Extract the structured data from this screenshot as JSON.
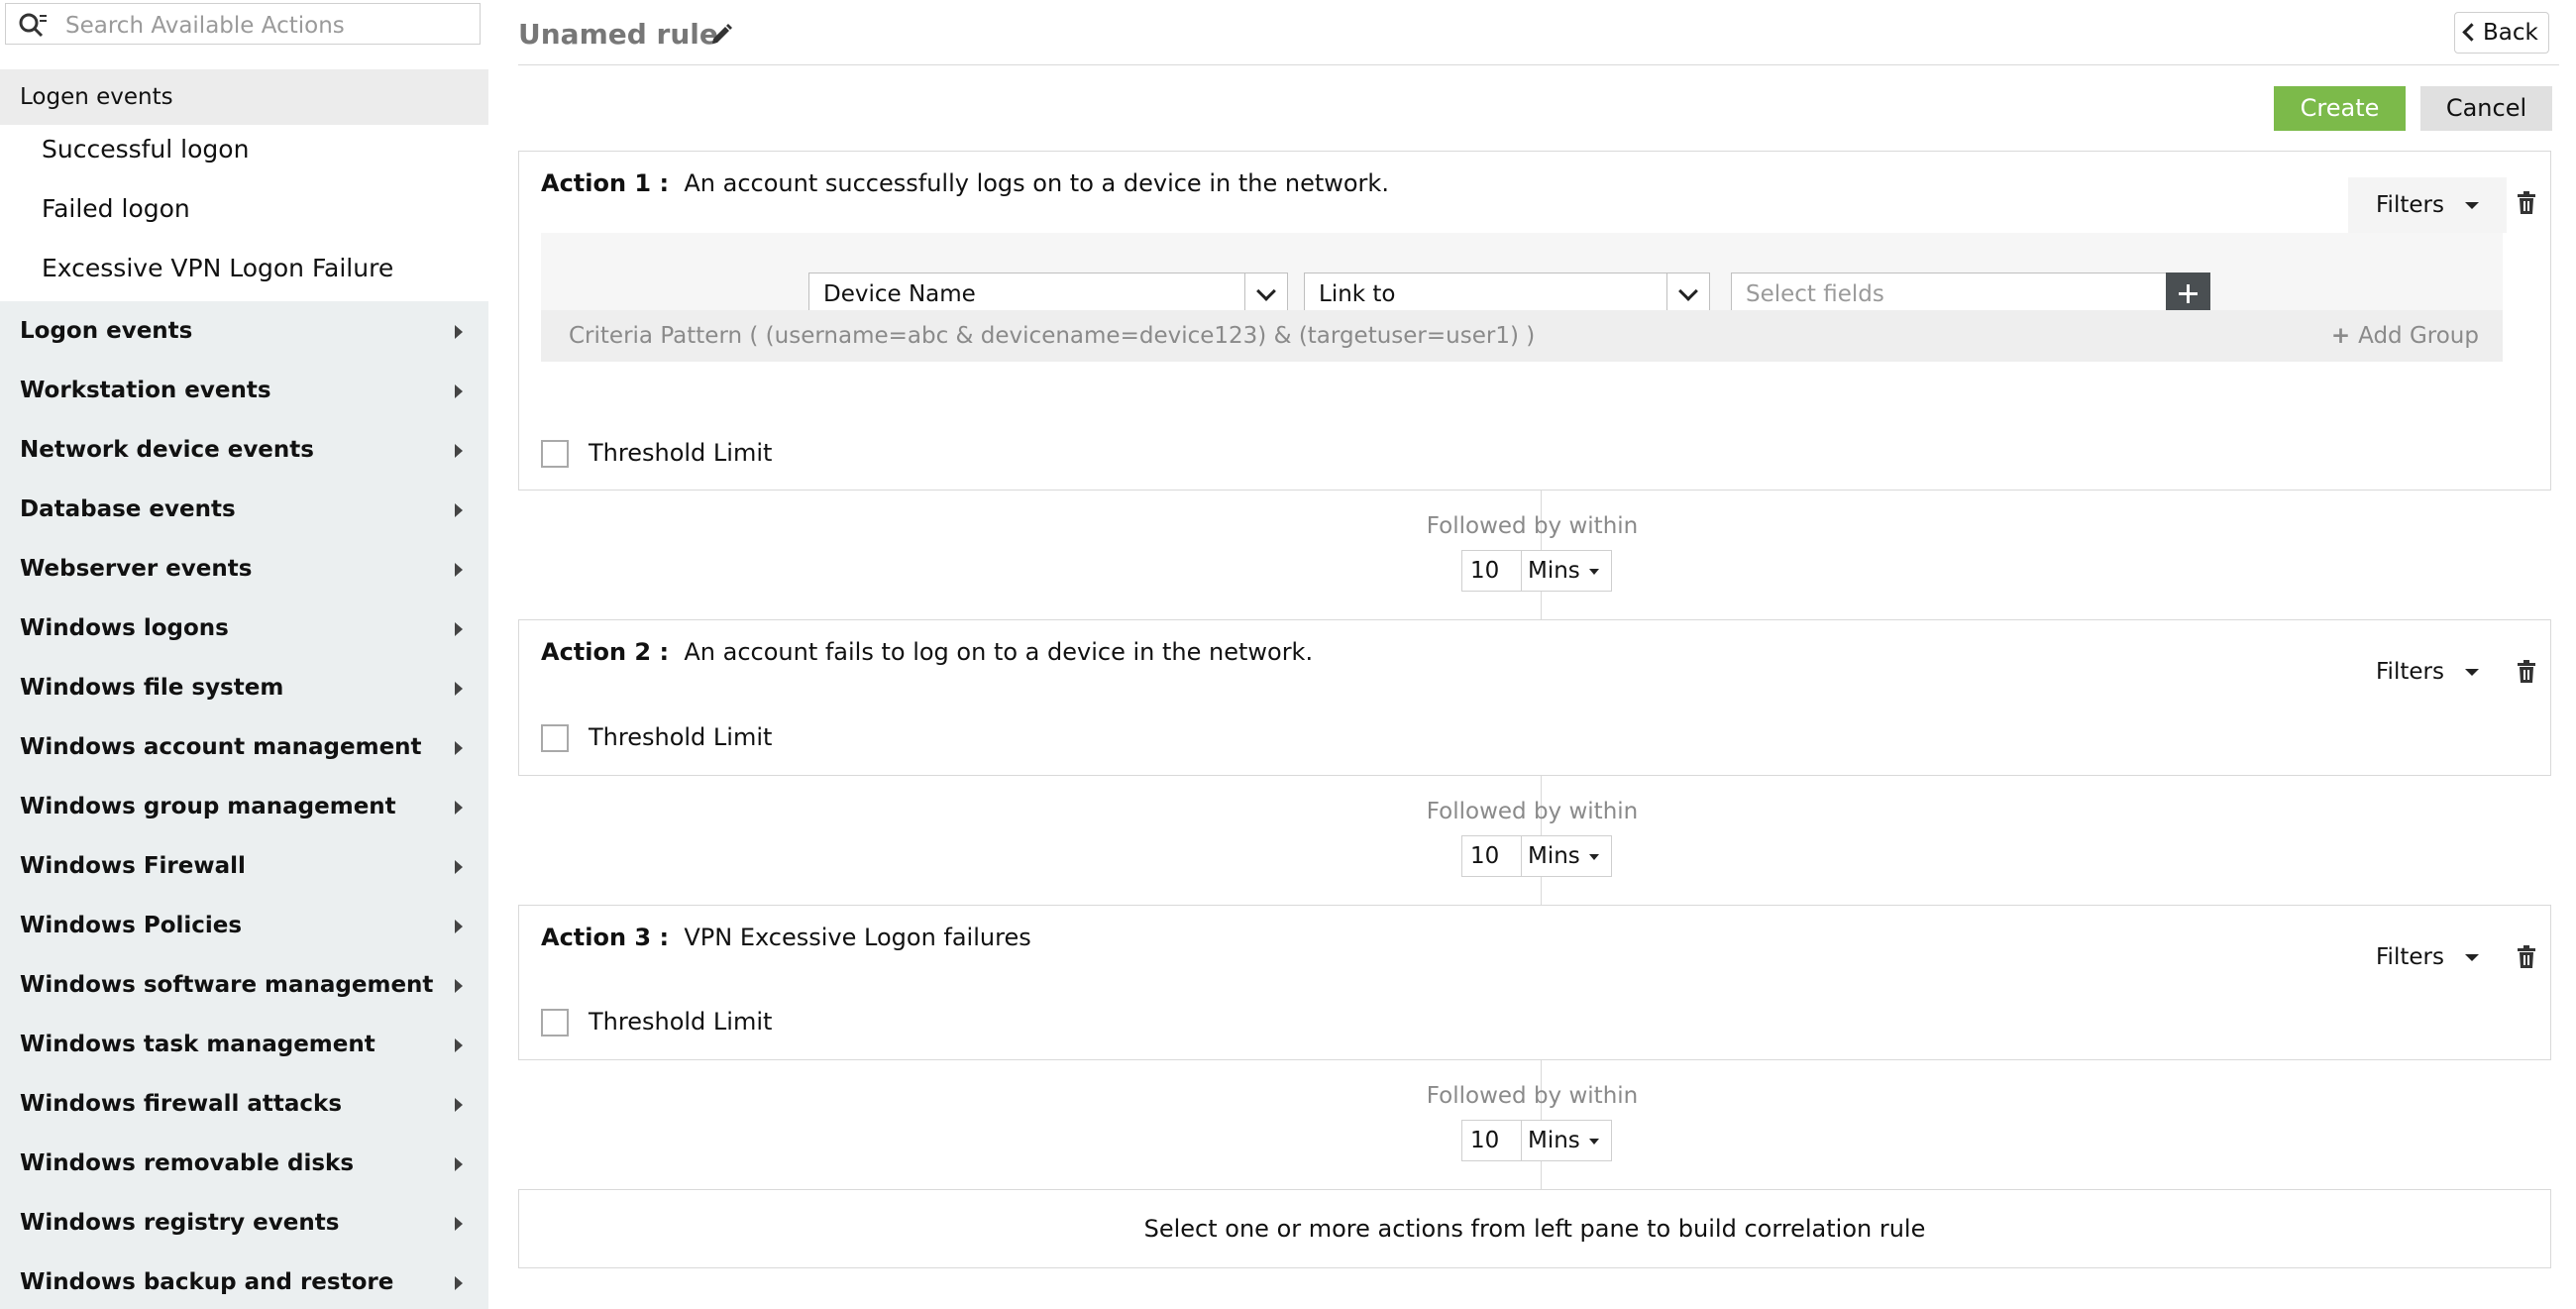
{
  "sidebar": {
    "search_placeholder": "Search Available Actions",
    "expanded_group": {
      "label": "Logen events",
      "items": [
        "Successful logon",
        "Failed logon",
        "Excessive VPN Logon Failure"
      ]
    },
    "categories": [
      "Logon events",
      "Workstation events",
      "Network device events",
      "Database events",
      "Webserver events",
      "Windows logons",
      "Windows file system",
      "Windows account management",
      "Windows group management",
      "Windows Firewall",
      "Windows Policies",
      "Windows software management",
      "Windows task management",
      "Windows firewall attacks",
      "Windows removable disks",
      "Windows registry events",
      "Windows backup and restore"
    ]
  },
  "header": {
    "rule_title": "Unamed rule",
    "back_label": "Back",
    "create_label": "Create",
    "cancel_label": "Cancel"
  },
  "actions": [
    {
      "label": "Action 1 :",
      "description": "An account successfully logs on to a device in the network.",
      "filters_label": "Filters",
      "threshold_label": "Threshold Limit",
      "criteria": {
        "field": "Device Name",
        "link": "Link to",
        "select_placeholder": "Select fields",
        "pattern": "Criteria Pattern ( (username=abc & devicename=device123) & (targetuser=user1) )",
        "add_group_label": "Add Group"
      }
    },
    {
      "label": "Action 2 :",
      "description": "An account fails to log on to a device in the network.",
      "filters_label": "Filters",
      "threshold_label": "Threshold Limit"
    },
    {
      "label": "Action 3 :",
      "description": "VPN Excessive Logon failures",
      "filters_label": "Filters",
      "threshold_label": "Threshold Limit"
    }
  ],
  "followed_by": [
    {
      "label": "Followed by within",
      "value": "10",
      "unit": "Mins"
    },
    {
      "label": "Followed by within",
      "value": "10",
      "unit": "Mins"
    },
    {
      "label": "Followed by within",
      "value": "10",
      "unit": "Mins"
    }
  ],
  "bottom_hint": "Select one or more actions from left pane to build correlation rule",
  "colors": {
    "create": "#7cba4a",
    "sidebar_bg": "#ebeff0",
    "plus_button": "#4a4f52"
  }
}
